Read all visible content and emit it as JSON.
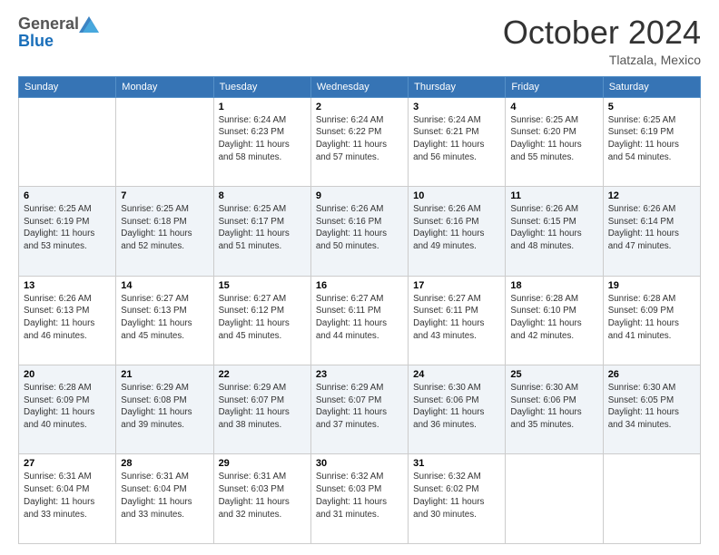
{
  "header": {
    "logo_general": "General",
    "logo_blue": "Blue",
    "month_title": "October 2024",
    "location": "Tlatzala, Mexico"
  },
  "days_of_week": [
    "Sunday",
    "Monday",
    "Tuesday",
    "Wednesday",
    "Thursday",
    "Friday",
    "Saturday"
  ],
  "weeks": [
    [
      {
        "day": "",
        "info": ""
      },
      {
        "day": "",
        "info": ""
      },
      {
        "day": "1",
        "info": "Sunrise: 6:24 AM\nSunset: 6:23 PM\nDaylight: 11 hours and 58 minutes."
      },
      {
        "day": "2",
        "info": "Sunrise: 6:24 AM\nSunset: 6:22 PM\nDaylight: 11 hours and 57 minutes."
      },
      {
        "day": "3",
        "info": "Sunrise: 6:24 AM\nSunset: 6:21 PM\nDaylight: 11 hours and 56 minutes."
      },
      {
        "day": "4",
        "info": "Sunrise: 6:25 AM\nSunset: 6:20 PM\nDaylight: 11 hours and 55 minutes."
      },
      {
        "day": "5",
        "info": "Sunrise: 6:25 AM\nSunset: 6:19 PM\nDaylight: 11 hours and 54 minutes."
      }
    ],
    [
      {
        "day": "6",
        "info": "Sunrise: 6:25 AM\nSunset: 6:19 PM\nDaylight: 11 hours and 53 minutes."
      },
      {
        "day": "7",
        "info": "Sunrise: 6:25 AM\nSunset: 6:18 PM\nDaylight: 11 hours and 52 minutes."
      },
      {
        "day": "8",
        "info": "Sunrise: 6:25 AM\nSunset: 6:17 PM\nDaylight: 11 hours and 51 minutes."
      },
      {
        "day": "9",
        "info": "Sunrise: 6:26 AM\nSunset: 6:16 PM\nDaylight: 11 hours and 50 minutes."
      },
      {
        "day": "10",
        "info": "Sunrise: 6:26 AM\nSunset: 6:16 PM\nDaylight: 11 hours and 49 minutes."
      },
      {
        "day": "11",
        "info": "Sunrise: 6:26 AM\nSunset: 6:15 PM\nDaylight: 11 hours and 48 minutes."
      },
      {
        "day": "12",
        "info": "Sunrise: 6:26 AM\nSunset: 6:14 PM\nDaylight: 11 hours and 47 minutes."
      }
    ],
    [
      {
        "day": "13",
        "info": "Sunrise: 6:26 AM\nSunset: 6:13 PM\nDaylight: 11 hours and 46 minutes."
      },
      {
        "day": "14",
        "info": "Sunrise: 6:27 AM\nSunset: 6:13 PM\nDaylight: 11 hours and 45 minutes."
      },
      {
        "day": "15",
        "info": "Sunrise: 6:27 AM\nSunset: 6:12 PM\nDaylight: 11 hours and 45 minutes."
      },
      {
        "day": "16",
        "info": "Sunrise: 6:27 AM\nSunset: 6:11 PM\nDaylight: 11 hours and 44 minutes."
      },
      {
        "day": "17",
        "info": "Sunrise: 6:27 AM\nSunset: 6:11 PM\nDaylight: 11 hours and 43 minutes."
      },
      {
        "day": "18",
        "info": "Sunrise: 6:28 AM\nSunset: 6:10 PM\nDaylight: 11 hours and 42 minutes."
      },
      {
        "day": "19",
        "info": "Sunrise: 6:28 AM\nSunset: 6:09 PM\nDaylight: 11 hours and 41 minutes."
      }
    ],
    [
      {
        "day": "20",
        "info": "Sunrise: 6:28 AM\nSunset: 6:09 PM\nDaylight: 11 hours and 40 minutes."
      },
      {
        "day": "21",
        "info": "Sunrise: 6:29 AM\nSunset: 6:08 PM\nDaylight: 11 hours and 39 minutes."
      },
      {
        "day": "22",
        "info": "Sunrise: 6:29 AM\nSunset: 6:07 PM\nDaylight: 11 hours and 38 minutes."
      },
      {
        "day": "23",
        "info": "Sunrise: 6:29 AM\nSunset: 6:07 PM\nDaylight: 11 hours and 37 minutes."
      },
      {
        "day": "24",
        "info": "Sunrise: 6:30 AM\nSunset: 6:06 PM\nDaylight: 11 hours and 36 minutes."
      },
      {
        "day": "25",
        "info": "Sunrise: 6:30 AM\nSunset: 6:06 PM\nDaylight: 11 hours and 35 minutes."
      },
      {
        "day": "26",
        "info": "Sunrise: 6:30 AM\nSunset: 6:05 PM\nDaylight: 11 hours and 34 minutes."
      }
    ],
    [
      {
        "day": "27",
        "info": "Sunrise: 6:31 AM\nSunset: 6:04 PM\nDaylight: 11 hours and 33 minutes."
      },
      {
        "day": "28",
        "info": "Sunrise: 6:31 AM\nSunset: 6:04 PM\nDaylight: 11 hours and 33 minutes."
      },
      {
        "day": "29",
        "info": "Sunrise: 6:31 AM\nSunset: 6:03 PM\nDaylight: 11 hours and 32 minutes."
      },
      {
        "day": "30",
        "info": "Sunrise: 6:32 AM\nSunset: 6:03 PM\nDaylight: 11 hours and 31 minutes."
      },
      {
        "day": "31",
        "info": "Sunrise: 6:32 AM\nSunset: 6:02 PM\nDaylight: 11 hours and 30 minutes."
      },
      {
        "day": "",
        "info": ""
      },
      {
        "day": "",
        "info": ""
      }
    ]
  ]
}
